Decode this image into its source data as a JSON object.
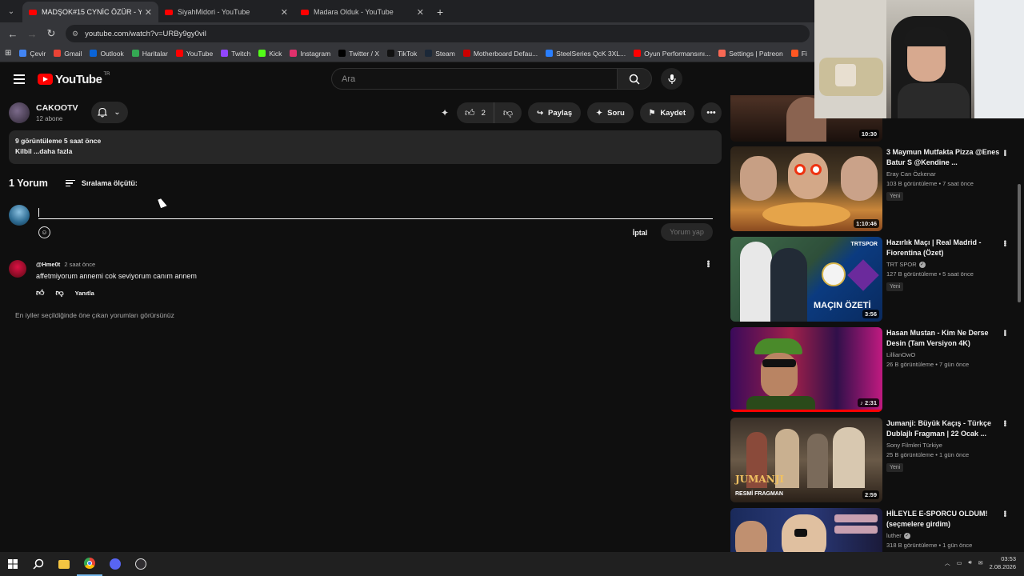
{
  "browser": {
    "tabs": [
      {
        "title": "MADŞOK#15 CYNİC ÖZÜR - Yo",
        "active": true
      },
      {
        "title": "SiyahMidori - YouTube",
        "active": false
      },
      {
        "title": "Madara Olduk - YouTube",
        "active": false
      }
    ],
    "url": "youtube.com/watch?v=URBy9gy0vil",
    "bookmarks": [
      {
        "label": "Çevir",
        "color": "#4285f4"
      },
      {
        "label": "Gmail",
        "color": "#ea4335"
      },
      {
        "label": "Outlook",
        "color": "#0a64d8"
      },
      {
        "label": "Haritalar",
        "color": "#34a853"
      },
      {
        "label": "YouTube",
        "color": "#ff0000"
      },
      {
        "label": "Twitch",
        "color": "#9146ff"
      },
      {
        "label": "Kick",
        "color": "#53fc18"
      },
      {
        "label": "Instagram",
        "color": "#e1306c"
      },
      {
        "label": "Twitter / X",
        "color": "#000000"
      },
      {
        "label": "TikTok",
        "color": "#111111"
      },
      {
        "label": "Steam",
        "color": "#1b2838"
      },
      {
        "label": "Motherboard Defau...",
        "color": "#cc0000"
      },
      {
        "label": "SteelSeries QcK 3XL...",
        "color": "#2a7fff"
      },
      {
        "label": "Oyun Performansını...",
        "color": "#ff0000"
      },
      {
        "label": "Settings | Patreon",
        "color": "#f96854"
      },
      {
        "label": "Fi",
        "color": "#ff5722"
      }
    ]
  },
  "youtube": {
    "logo_text": "YouTube",
    "region": "TR",
    "search_placeholder": "Ara"
  },
  "channel": {
    "name": "CAKOOTV",
    "subscribers": "12 abone"
  },
  "actions": {
    "like_count": "2",
    "share": "Paylaş",
    "ask": "Soru",
    "save": "Kaydet"
  },
  "description": {
    "meta": "9 görüntüleme  5 saat önce",
    "text": "Kilbil ...daha fazla"
  },
  "comments": {
    "count_label": "1 Yorum",
    "sort_label": "Sıralama ölçütü:",
    "cancel": "İptal",
    "submit": "Yorum yap",
    "items": [
      {
        "user": "@Hme0t",
        "time": "2 saat önce",
        "text": "affetmiyorum annemi cok seviyorum canım annem",
        "reply": "Yanıtla"
      }
    ],
    "hint": "En iyiler seçildiğinde öne çıkan yorumları görürsünüz"
  },
  "sidebar": {
    "top_duration": "10:30",
    "videos": [
      {
        "title": "3 Maymun Mutfakta Pizza @Enes Batur S @Kendine ...",
        "channel": "Eray Can Özkenar",
        "meta": "103 B görüntüleme • 7 saat önce",
        "badge": "Yeni",
        "duration": "1:10:46",
        "verified": false
      },
      {
        "title": "Hazırlık Maçı | Real Madrid - Fiorentina (Özet)",
        "channel": "TRT SPOR",
        "meta": "127 B görüntüleme • 5 saat önce",
        "badge": "Yeni",
        "duration": "3:56",
        "verified": true,
        "thumb_text": "MAÇIN ÖZETİ",
        "thumb_logo": "TRTSPOR"
      },
      {
        "title": "Hasan Mustan - Kim Ne Derse Desin (Tam Versiyon 4K)",
        "channel": "LillianOwO",
        "meta": "26 B görüntüleme • 7 gün önce",
        "badge": "",
        "duration": "2:31",
        "verified": false
      },
      {
        "title": "Jumanji: Büyük Kaçış - Türkçe Dublajlı Fragman | 22 Ocak ...",
        "channel": "Sony Filmleri Türkiye",
        "meta": "25 B görüntüleme • 1 gün önce",
        "badge": "Yeni",
        "duration": "2:59",
        "verified": false,
        "thumb_text": "JUMANJI",
        "thumb_sub": "RESMİ FRAGMAN"
      },
      {
        "title": "HİLEYLE E-SPORCU OLDUM! (seçmelere girdim)",
        "channel": "luther",
        "meta": "318 B görüntüleme • 1 gün önce",
        "badge": "",
        "duration": "",
        "verified": true
      }
    ]
  },
  "taskbar": {
    "time": "03:53",
    "date": "2.08.2026"
  }
}
